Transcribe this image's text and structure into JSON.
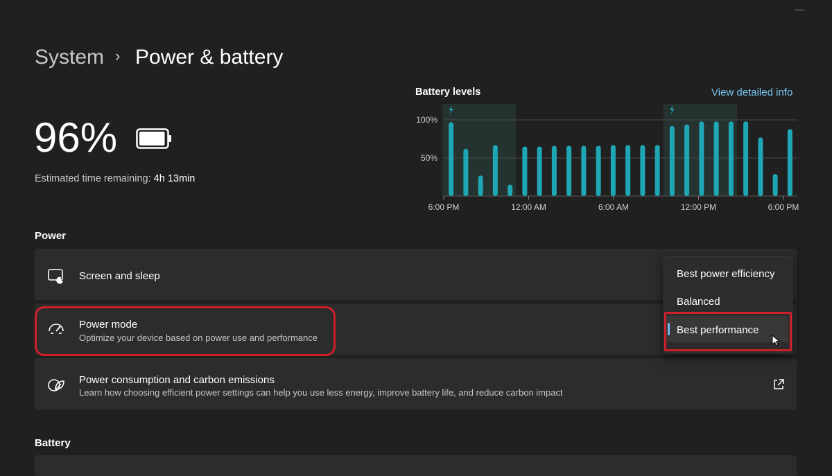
{
  "window": {
    "minimize_icon": "minimize-icon"
  },
  "breadcrumb": {
    "parent": "System",
    "separator": "›",
    "current": "Power & battery"
  },
  "battery_summary": {
    "percent": "96%",
    "level": 0.96,
    "estimate_label": "Estimated time remaining:",
    "estimate_value": "4h 13min"
  },
  "chart_header": {
    "title": "Battery levels",
    "link": "View detailed info"
  },
  "chart_data": {
    "type": "bar",
    "title": "Battery levels",
    "y_ticks": [
      "100%",
      "50%"
    ],
    "ylim": [
      0,
      100
    ],
    "x_tick_labels": [
      "6:00 PM",
      "12:00 AM",
      "6:00 AM",
      "12:00 PM",
      "6:00 PM"
    ],
    "values": [
      97,
      62,
      27,
      67,
      15,
      65,
      65,
      66,
      66,
      66,
      66,
      67,
      67,
      67,
      67,
      92,
      94,
      98,
      98,
      98,
      98,
      77,
      29,
      88
    ],
    "charging_intervals": [
      [
        0,
        5
      ],
      [
        15,
        20
      ]
    ],
    "grid": true,
    "bar_color": "#1fa6b4",
    "charging_band_color": "#243330"
  },
  "sections": {
    "power": "Power",
    "battery": "Battery"
  },
  "cards": [
    {
      "title": "Screen and sleep",
      "desc": "",
      "icon": "screen-sleep-icon"
    },
    {
      "title": "Power mode",
      "desc": "Optimize your device based on power use and performance",
      "icon": "speedometer-icon"
    },
    {
      "title": "Power consumption and carbon emissions",
      "desc": "Learn how choosing efficient power settings can help you use less energy, improve battery life, and reduce carbon impact",
      "icon": "leaf-icon",
      "trailing_icon": "external-link-icon"
    }
  ],
  "power_mode_menu": {
    "options": [
      "Best power efficiency",
      "Balanced",
      "Best performance"
    ],
    "selected": "Best performance"
  },
  "colors": {
    "accent": "#76b9ed",
    "highlight": "#d01f2a",
    "link": "#77c4ee"
  }
}
